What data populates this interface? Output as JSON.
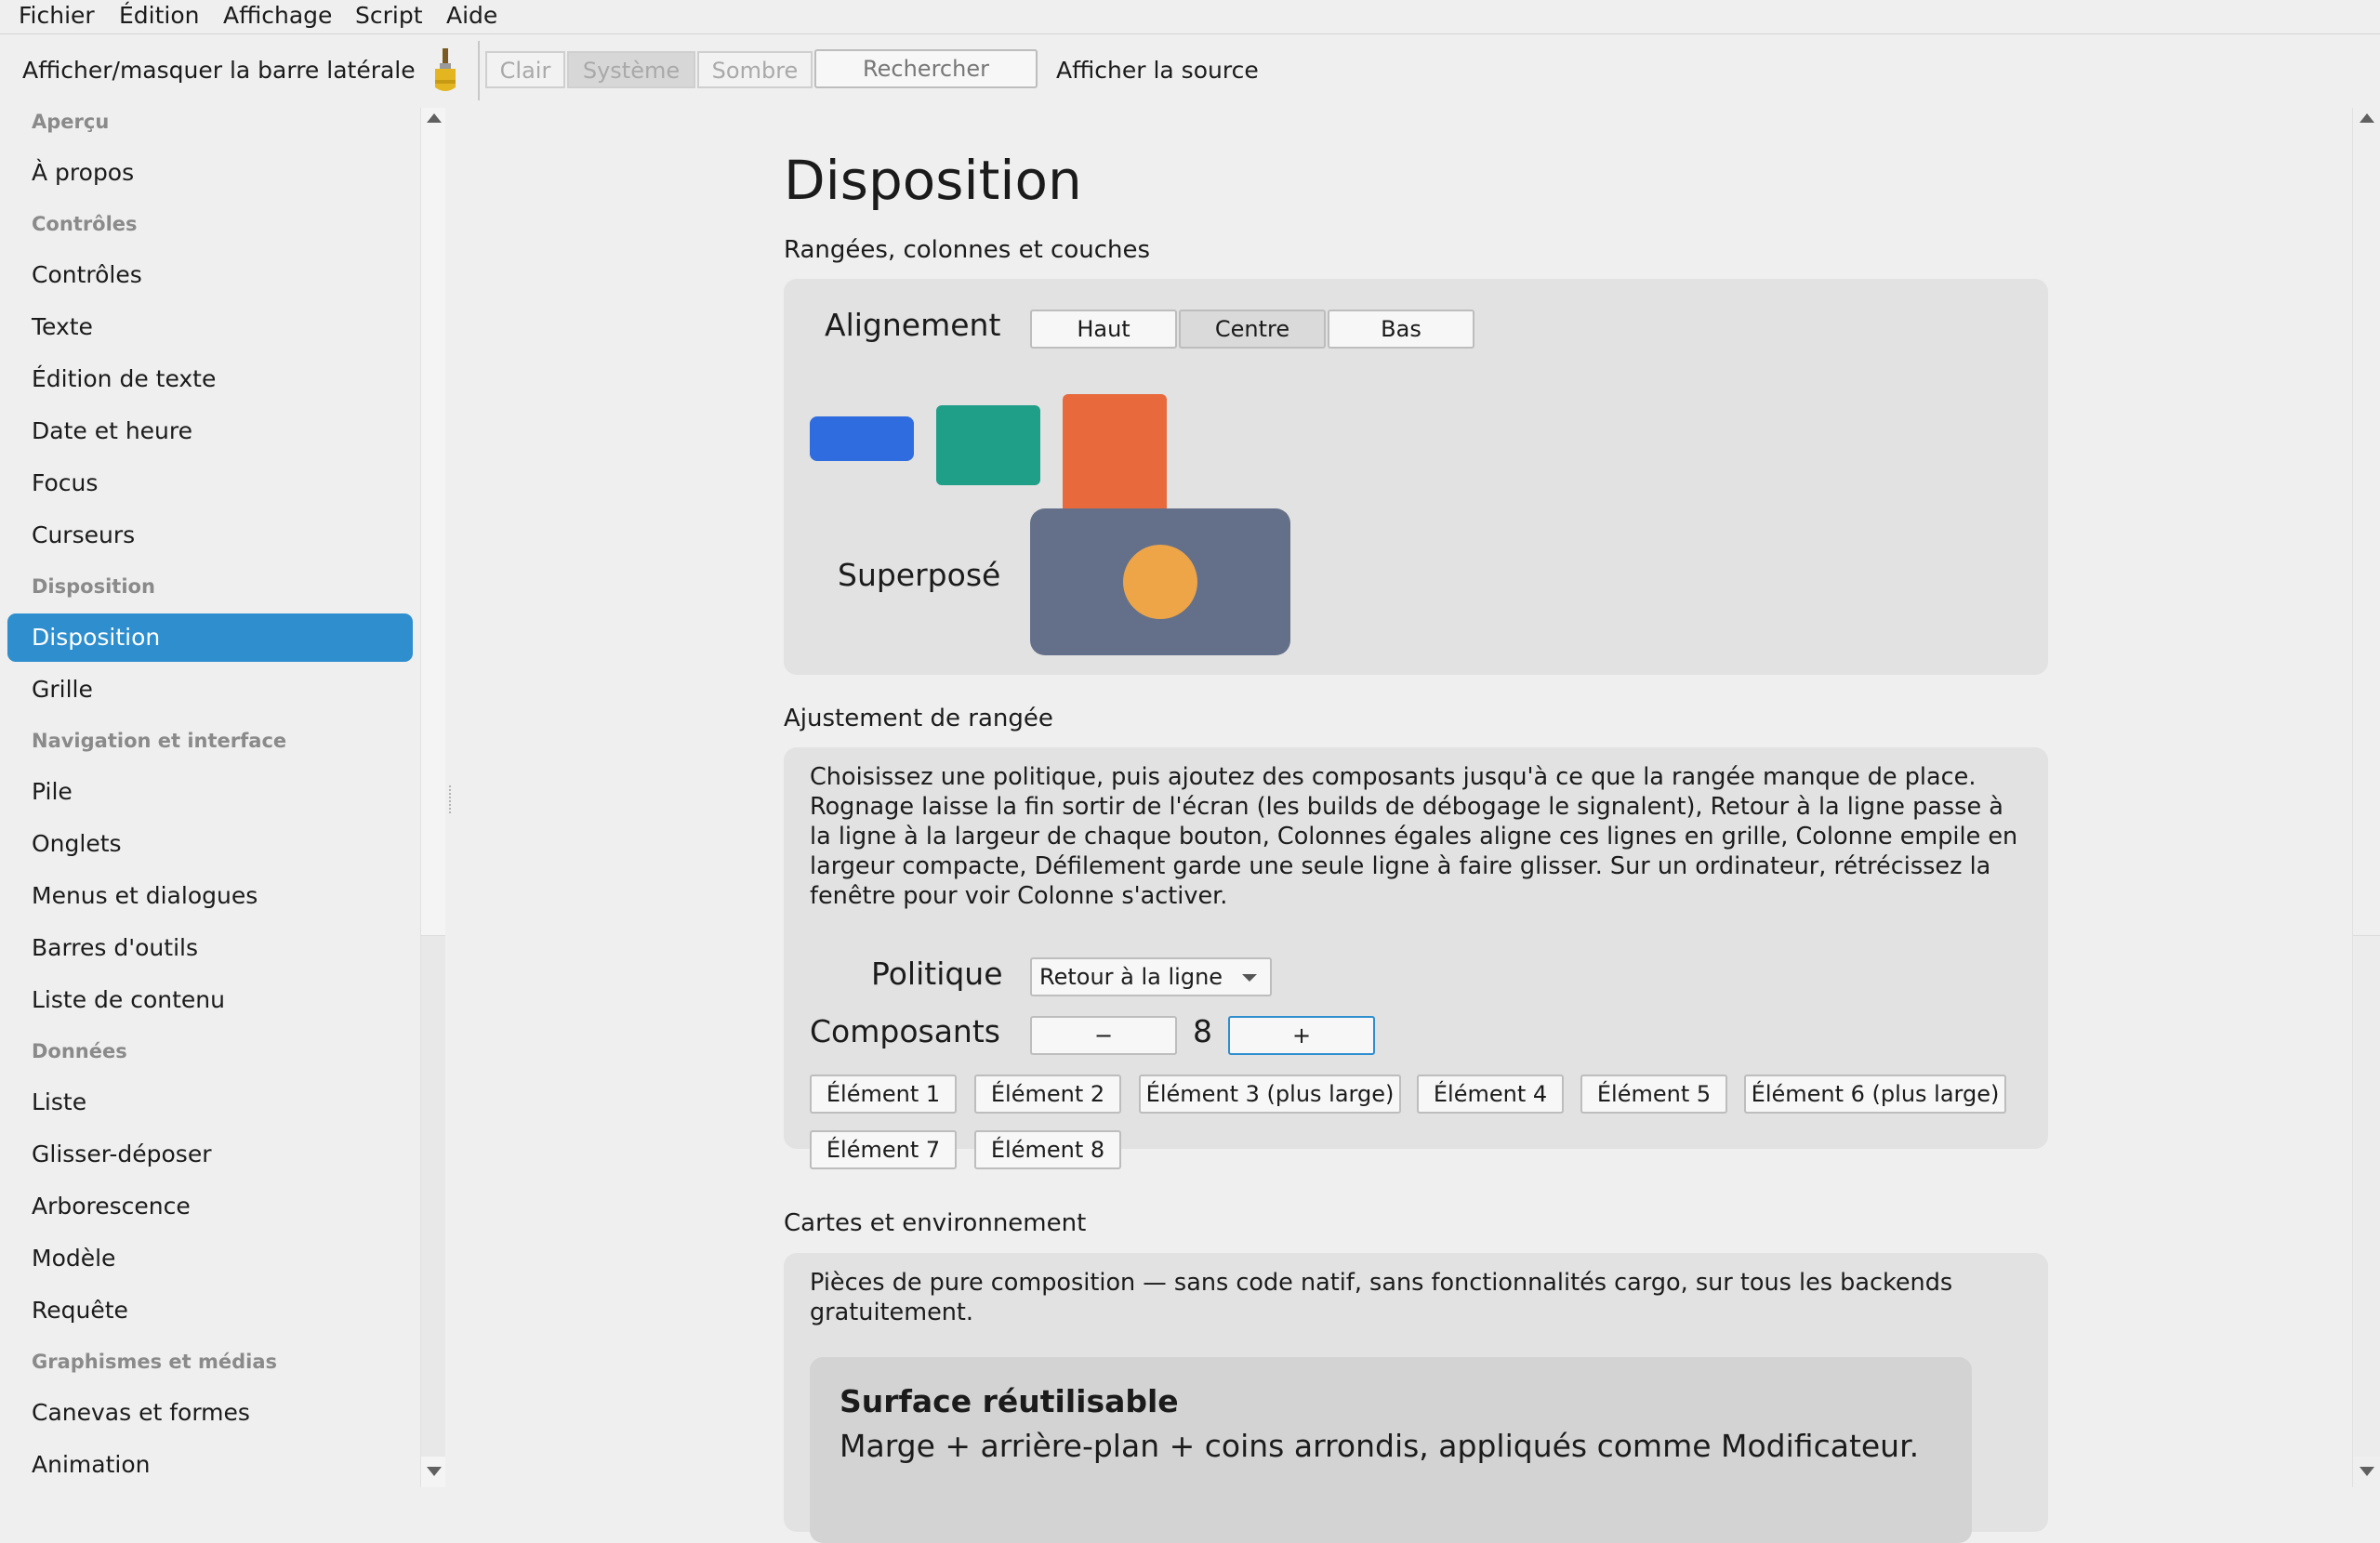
{
  "menubar": {
    "items": [
      "Fichier",
      "Édition",
      "Affichage",
      "Script",
      "Aide"
    ]
  },
  "toolbar": {
    "toggle_sidebar": "Afficher/masquer la barre latérale",
    "theme_buttons": [
      {
        "label": "Clair",
        "selected": false
      },
      {
        "label": "Système",
        "selected": true
      },
      {
        "label": "Sombre",
        "selected": false
      }
    ],
    "search_placeholder": "Rechercher",
    "show_source": "Afficher la source"
  },
  "sidebar": {
    "sections": [
      {
        "heading": "Aperçu",
        "items": [
          "À propos"
        ]
      },
      {
        "heading": "Contrôles",
        "items": [
          "Contrôles",
          "Texte",
          "Édition de texte",
          "Date et heure",
          "Focus",
          "Curseurs"
        ]
      },
      {
        "heading": "Disposition",
        "items": [
          "Disposition",
          "Grille"
        ]
      },
      {
        "heading": "Navigation et interface",
        "items": [
          "Pile",
          "Onglets",
          "Menus et dialogues",
          "Barres d'outils",
          "Liste de contenu"
        ]
      },
      {
        "heading": "Données",
        "items": [
          "Liste",
          "Glisser-déposer",
          "Arborescence",
          "Modèle",
          "Requête"
        ]
      },
      {
        "heading": "Graphismes et médias",
        "items": [
          "Canevas et formes",
          "Animation"
        ]
      }
    ],
    "selected": "Disposition"
  },
  "main": {
    "title": "Disposition",
    "rows_section": {
      "heading": "Rangées, colonnes et couches",
      "alignment_label": "Alignement",
      "alignment_options": [
        {
          "label": "Haut",
          "selected": false
        },
        {
          "label": "Centre",
          "selected": true
        },
        {
          "label": "Bas",
          "selected": false
        }
      ],
      "swatch_colors": [
        "#2f6ce0",
        "#1f9e88",
        "#e8693c"
      ],
      "overlay_label": "Superposé",
      "overlay_bg": "#647089",
      "overlay_dot": "#eea548"
    },
    "wrap_section": {
      "heading": "Ajustement de rangée",
      "description": "Choisissez une politique, puis ajoutez des composants jusqu'à ce que la rangée manque de place. Rognage laisse la fin sortir de l'écran (les builds de débogage le signalent), Retour à la ligne passe à la ligne à la largeur de chaque bouton, Colonnes égales aligne ces lignes en grille, Colonne empile en largeur compacte, Défilement garde une seule ligne à faire glisser. Sur un ordinateur, rétrécissez la fenêtre pour voir Colonne s'activer.",
      "policy_label": "Politique",
      "policy_value": "Retour à la ligne",
      "components_label": "Composants",
      "minus": "−",
      "plus": "+",
      "count": "8",
      "elements": [
        "Élément 1",
        "Élément 2",
        "Élément 3 (plus large)",
        "Élément 4",
        "Élément 5",
        "Élément 6 (plus large)",
        "Élément 7",
        "Élément 8"
      ]
    },
    "cards_section": {
      "heading": "Cartes et environnement",
      "description": "Pièces de pure composition — sans code natif, sans fonctionnalités cargo, sur tous les backends gratuitement.",
      "surface_title": "Surface réutilisable",
      "surface_text": "Marge + arrière-plan + coins arrondis, appliqués comme Modificateur."
    }
  }
}
